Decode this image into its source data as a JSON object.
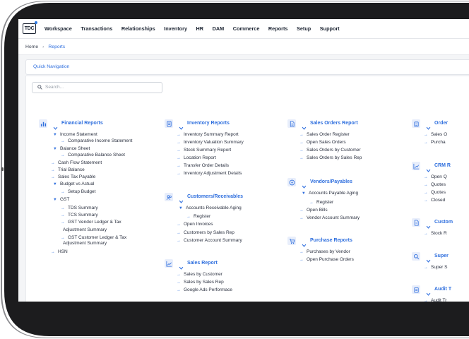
{
  "app": {
    "logo_text": "TDC"
  },
  "nav": [
    "Workspace",
    "Transactions",
    "Relationships",
    "Inventory",
    "HR",
    "DAM",
    "Commerce",
    "Reports",
    "Setup",
    "Support"
  ],
  "breadcrumb": {
    "home": "Home",
    "separator": "›",
    "current": "Reports"
  },
  "quick_nav": {
    "label": "Quick Navigation"
  },
  "search": {
    "placeholder": "Search..."
  },
  "colors": {
    "accent": "#2f6fde",
    "icon_bg": "#e8eefb",
    "text": "#2b3140",
    "bezel": "#1c1c1e"
  },
  "sections": [
    {
      "title": "Financial Reports",
      "icon": "bar-chart-icon",
      "items": [
        {
          "label": "Income Statement",
          "level": 1,
          "marker": "caret"
        },
        {
          "label": "Comparative Income Statement",
          "level": 2,
          "marker": "arrow"
        },
        {
          "label": "Balance Sheet",
          "level": 1,
          "marker": "caret"
        },
        {
          "label": "Comparative Balance Sheet",
          "level": 2,
          "marker": "arrow"
        },
        {
          "label": "Cash Flow Statement",
          "level": 0,
          "marker": "arrow"
        },
        {
          "label": "Trial Balance",
          "level": 0,
          "marker": "arrow"
        },
        {
          "label": "Sales Tax Payable",
          "level": 0,
          "marker": "arrow"
        },
        {
          "label": "Budget vs Actual",
          "level": 1,
          "marker": "caret"
        },
        {
          "label": "Setup Budget",
          "level": 2,
          "marker": "arrow"
        },
        {
          "label": "GST",
          "level": 1,
          "marker": "caret"
        },
        {
          "label": "TDS Summary",
          "level": 2,
          "marker": "arrow"
        },
        {
          "label": "TCS Summary",
          "level": 2,
          "marker": "arrow"
        },
        {
          "label": "GST Vendor Ledger & Tax",
          "level": 2,
          "marker": "arrow"
        },
        {
          "label": "Adjustment Summary",
          "level": 3,
          "marker": "none"
        },
        {
          "label": "GST Customer Ledger & Tax",
          "level": 2,
          "marker": "arrow"
        },
        {
          "label": "Adjustment Summary",
          "level": 3,
          "marker": "none"
        },
        {
          "label": "HSN",
          "level": 0,
          "marker": "arrow"
        }
      ]
    },
    {
      "title": "Inventory Reports",
      "icon": "calculator-icon",
      "items": [
        {
          "label": "Inventory Summary Report",
          "level": 0,
          "marker": "arrow"
        },
        {
          "label": "Inventory Valuation Summary",
          "level": 0,
          "marker": "arrow"
        },
        {
          "label": "Stock Summary Report",
          "level": 0,
          "marker": "arrow"
        },
        {
          "label": "Location Report",
          "level": 0,
          "marker": "arrow"
        },
        {
          "label": "Transfer Order Details",
          "level": 0,
          "marker": "arrow"
        },
        {
          "label": "Inventory Adjustment Details",
          "level": 0,
          "marker": "arrow"
        }
      ]
    },
    {
      "title": "Customers/Receivables",
      "icon": "users-icon",
      "items": [
        {
          "label": "Accounts Receivable Aging",
          "level": 1,
          "marker": "caret"
        },
        {
          "label": "Register",
          "level": 2,
          "marker": "arrow"
        },
        {
          "label": "Open Invoices",
          "level": 0,
          "marker": "arrow"
        },
        {
          "label": "Customers by Sales Rep",
          "level": 0,
          "marker": "arrow"
        },
        {
          "label": "Customer Account Summary",
          "level": 0,
          "marker": "arrow"
        }
      ]
    },
    {
      "title": "Sales Report",
      "icon": "line-chart-icon",
      "items": [
        {
          "label": "Sales by Customer",
          "level": 0,
          "marker": "arrow"
        },
        {
          "label": "Sales by Sales Rep",
          "level": 0,
          "marker": "arrow"
        },
        {
          "label": "Google Ads Performace",
          "level": 0,
          "marker": "arrow"
        }
      ]
    },
    {
      "title": "Sales Orders Report",
      "icon": "document-icon",
      "items": [
        {
          "label": "Sales Order Register",
          "level": 0,
          "marker": "arrow"
        },
        {
          "label": "Open Sales Orders",
          "level": 0,
          "marker": "arrow"
        },
        {
          "label": "Sales Orders by Customer",
          "level": 0,
          "marker": "arrow"
        },
        {
          "label": "Sales Orders by Sales Rep",
          "level": 0,
          "marker": "arrow"
        }
      ]
    },
    {
      "title": "Vendors/Payables",
      "icon": "dollar-circle-icon",
      "items": [
        {
          "label": "Accounts Payable Aging",
          "level": 1,
          "marker": "caret"
        },
        {
          "label": "Register",
          "level": 2,
          "marker": "arrow"
        },
        {
          "label": "Open Bills",
          "level": 0,
          "marker": "arrow"
        },
        {
          "label": "Vendor Account Summary",
          "level": 0,
          "marker": "arrow"
        }
      ]
    },
    {
      "title": "Purchase Reports",
      "icon": "cart-icon",
      "items": [
        {
          "label": "Purchases by Vendor",
          "level": 0,
          "marker": "arrow"
        },
        {
          "label": "Open Purchase Orders",
          "level": 0,
          "marker": "arrow"
        }
      ]
    },
    {
      "title": "Order",
      "icon": "clipboard-icon",
      "items": [
        {
          "label": "Sales O",
          "level": 0,
          "marker": "arrow"
        },
        {
          "label": "Purcha",
          "level": 0,
          "marker": "arrow"
        }
      ]
    },
    {
      "title": "CRM R",
      "icon": "trend-icon",
      "items": [
        {
          "label": "Open Q",
          "level": 0,
          "marker": "arrow"
        },
        {
          "label": "Quotes",
          "level": 0,
          "marker": "arrow"
        },
        {
          "label": "Quotes",
          "level": 0,
          "marker": "arrow"
        },
        {
          "label": "Closed",
          "level": 0,
          "marker": "arrow"
        }
      ]
    },
    {
      "title": "Custom",
      "icon": "report-icon",
      "items": [
        {
          "label": "Stock R",
          "level": 0,
          "marker": "arrow"
        }
      ]
    },
    {
      "title": "Super",
      "icon": "search-icon",
      "items": [
        {
          "label": "Super S",
          "level": 0,
          "marker": "arrow"
        }
      ]
    },
    {
      "title": "Audit T",
      "icon": "audit-icon",
      "items": [
        {
          "label": "Audit Tr",
          "level": 0,
          "marker": "arrow"
        }
      ]
    }
  ]
}
